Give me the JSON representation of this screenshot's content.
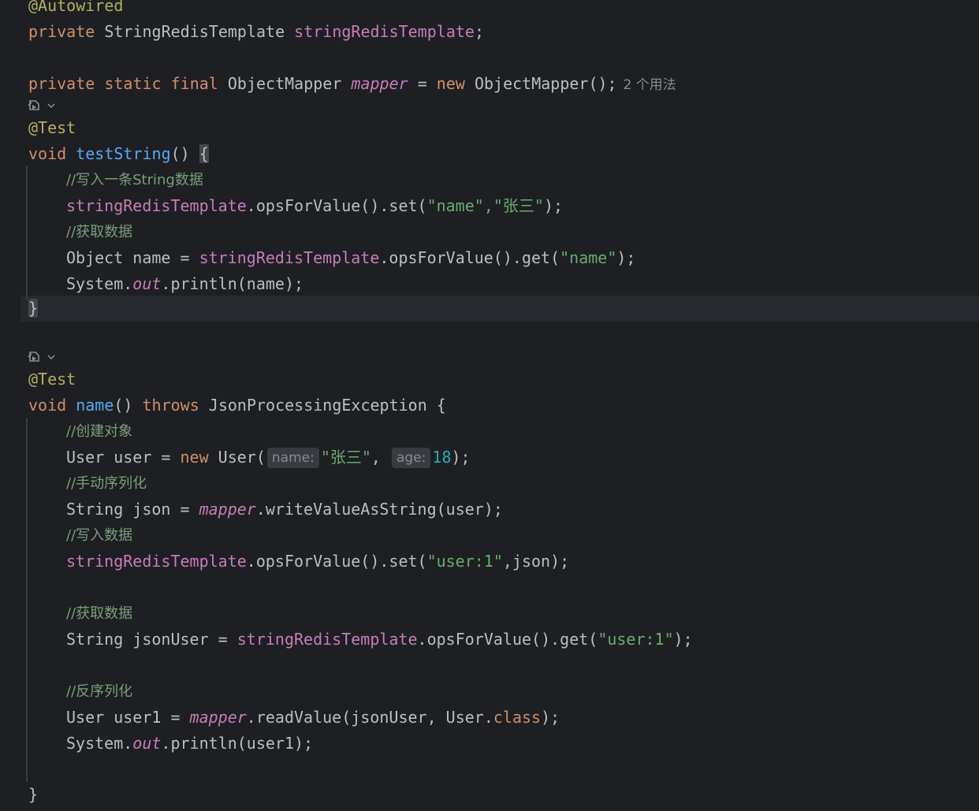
{
  "editor": {
    "lines": {
      "autowired": "@Autowired",
      "field_decl": {
        "kw": "private",
        "type": " StringRedisTemplate ",
        "name": "stringRedisTemplate",
        "end": ";"
      },
      "mapper_decl": {
        "kw": "private static final",
        "type": " ObjectMapper ",
        "name": "mapper",
        "eq": " = ",
        "new": "new",
        "ctor": " ObjectMapper();",
        "usages": "2 个用法"
      },
      "test1": {
        "annotation": "@Test",
        "void": "void",
        "method": "testString",
        "parens": "() ",
        "open_brace": "{",
        "comment1": "//写入一条String数据",
        "set_field": "stringRedisTemplate",
        "set_call": ".opsForValue().set(",
        "set_key": "\"name\"",
        "set_comma": ",",
        "set_value": "\"张三\"",
        "set_end": ");",
        "comment2": "//获取数据",
        "get_prefix": "Object name = ",
        "get_field": "stringRedisTemplate",
        "get_call": ".opsForValue().get(",
        "get_key": "\"name\"",
        "get_end": ");",
        "print_prefix": "System.",
        "print_out": "out",
        "print_rest": ".println(name);",
        "close_brace": "}"
      },
      "test2": {
        "annotation": "@Test",
        "void": "void",
        "method": "name",
        "parens": "() ",
        "throws": "throws",
        "exception": " JsonProcessingException {",
        "comment1": "//创建对象",
        "user_prefix": "User user = ",
        "user_new": "new",
        "user_ctor": " User(",
        "hint_name": "name:",
        "user_name": "\"张三\"",
        "user_comma": ", ",
        "hint_age": "age:",
        "user_age": "18",
        "user_end": ");",
        "comment2": "//手动序列化",
        "json_prefix": "String json = ",
        "json_mapper": "mapper",
        "json_rest": ".writeValueAsString(user);",
        "comment3": "//写入数据",
        "set_field": "stringRedisTemplate",
        "set_call": ".opsForValue().set(",
        "set_key": "\"user:1\"",
        "set_rest": ",json);",
        "comment4": "//获取数据",
        "get_prefix": "String jsonUser = ",
        "get_field": "stringRedisTemplate",
        "get_call": ".opsForValue().get(",
        "get_key": "\"user:1\"",
        "get_end": ");",
        "comment5": "//反序列化",
        "read_prefix": "User user1 = ",
        "read_mapper": "mapper",
        "read_call": ".readValue(jsonUser, User.",
        "read_class": "class",
        "read_end": ");",
        "print_prefix": "System.",
        "print_out": "out",
        "print_rest": ".println(user1);",
        "close_brace": "}"
      }
    },
    "icons": {
      "run_test_1": "run-test-icon",
      "run_test_2": "run-test-icon"
    }
  }
}
